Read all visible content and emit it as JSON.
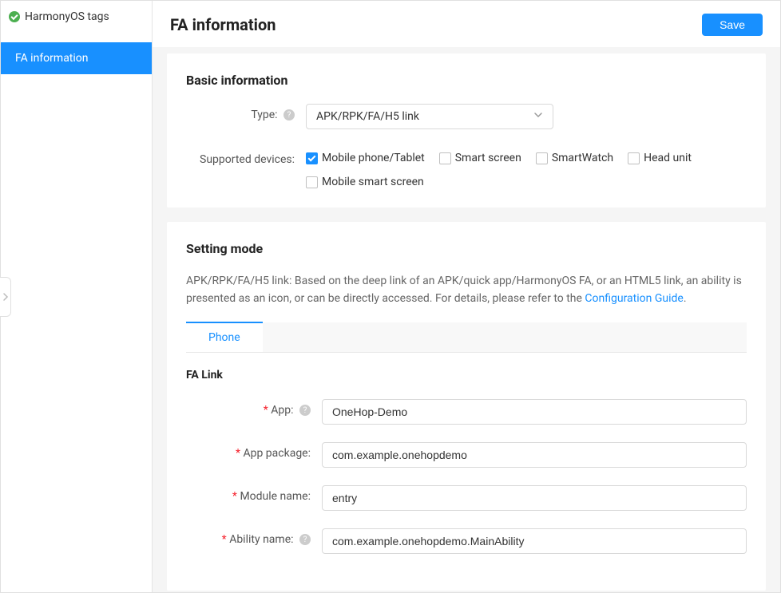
{
  "sidebar": {
    "header": "HarmonyOS tags",
    "items": [
      {
        "label": "FA information"
      }
    ]
  },
  "page": {
    "title": "FA information",
    "save_label": "Save"
  },
  "basic": {
    "title": "Basic information",
    "type_label": "Type:",
    "type_value": "APK/RPK/FA/H5 link",
    "devices_label": "Supported devices:",
    "devices": {
      "mobile_tablet": "Mobile phone/Tablet",
      "smart_screen": "Smart screen",
      "smartwatch": "SmartWatch",
      "head_unit": "Head unit",
      "mobile_smart_screen": "Mobile smart screen"
    }
  },
  "setting": {
    "title": "Setting mode",
    "desc_part1": "APK/RPK/FA/H5 link: Based on the deep link of an APK/quick app/HarmonyOS FA, or an HTML5 link, an ability is presented as an icon, or can be directly accessed. For details, please refer to the ",
    "desc_link": "Configuration Guide",
    "desc_part2": ".",
    "tabs": [
      {
        "label": "Phone"
      }
    ],
    "fa_link_title": "FA Link",
    "app_label": "App:",
    "app_value": "OneHop-Demo",
    "package_label": "App package:",
    "package_value": "com.example.onehopdemo",
    "module_label": "Module name:",
    "module_value": "entry",
    "ability_label": "Ability name:",
    "ability_value": "com.example.onehopdemo.MainAbility"
  }
}
